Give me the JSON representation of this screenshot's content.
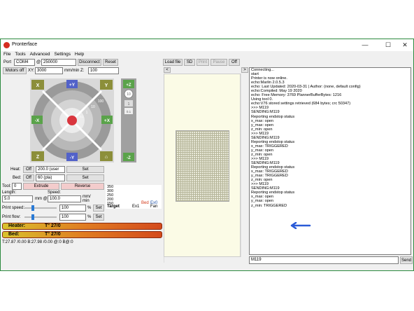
{
  "window": {
    "title": "Pronterface",
    "minimize": "—",
    "maximize": "☐",
    "close": "✕"
  },
  "menu": [
    "File",
    "Tools",
    "Advanced",
    "Settings",
    "Help"
  ],
  "toolbar": {
    "port_label": "Port",
    "port_value": "COM4",
    "at": "@",
    "baud_value": "250000",
    "disconnect": "Disconnect",
    "reset": "Reset",
    "motors_off": "Motors off",
    "xy_label": "XY:",
    "xy_speed": "3000",
    "z_label": "mm/min Z:",
    "z_speed": "100"
  },
  "jog": {
    "home_x": "X",
    "home_y": "Y",
    "home_z": "Z",
    "home_all": "⌂",
    "plus_y": "+Y",
    "minus_y": "-Y",
    "plus_x": "+X",
    "minus_x": "-X",
    "ring_labels": [
      "100",
      "10",
      "1",
      "0.1"
    ],
    "z_steps": [
      "10",
      "1",
      "0.1"
    ],
    "plus_z": "+Z",
    "minus_z": "-Z"
  },
  "temp": {
    "heat_label": "Heat:",
    "heat_off": "Off",
    "heat_value": "200.0 (user",
    "set": "Set",
    "bed_label": "Bed:",
    "bed_off": "Off",
    "bed_value": "60 (pla)",
    "tool_label": "Tool:",
    "tool_value": "0",
    "extrude": "Extrude",
    "reverse": "Reverse",
    "length_label": "Length:",
    "length_value": "5.0",
    "mm_at": "mm @",
    "speed_label": "Speed:",
    "speed_value": "100.0",
    "mm_min": "mm/\nmin",
    "print_speed_label": "Print speed:",
    "print_speed_value": "100",
    "pct": "%",
    "print_flow_label": "Print flow:",
    "print_flow_value": "100"
  },
  "graph": {
    "ticks": [
      "350",
      "300",
      "250",
      "200",
      "150",
      "100",
      "50"
    ],
    "legend_target": "Target",
    "legend_ex1": "Ex1",
    "legend_bed": "Bed",
    "legend_ex0": "Ex0",
    "legend_fan": "Fan"
  },
  "gauges": {
    "heater": "Heater:",
    "heater_val": "T° 27/0",
    "bed": "Bed:",
    "bed_val": "T° 27/0"
  },
  "status": "T:27.87 /0.00 B:27.98 /0.00 @:0 B@:0",
  "center": {
    "load_file": "Load file",
    "sd": "SD",
    "print": "Print",
    "pause": "Pause",
    "off": "Off",
    "prev": "<",
    "next": ">"
  },
  "console_lines": [
    "Connecting...",
    "start",
    "Printer is now online.",
    "echo:Marlin 2.0.5.3",
    "echo: Last Updated: 2020-03-31 | Author: (none, default config)",
    "echo:Compiled: May 19 2020",
    "echo: Free Memory: 3769  PlannerBufferBytes: 1216",
    "Using tool 0.",
    "echo:V76 stored settings retrieved (684 bytes; crc 50347)",
    ">>> M119",
    "SENDING:M119",
    "Reporting endstop status",
    "x_max: open",
    "y_max: open",
    "z_min: open",
    ">>> M119",
    "SENDING:M119",
    "Reporting endstop status",
    "x_max: TRIGGERED",
    "y_max: open",
    "z_min: open",
    ">>> M119",
    "SENDING:M119",
    "Reporting endstop status",
    "x_max: TRIGGERED",
    "y_max: TRIGGERED",
    "z_min: open",
    ">>> M119",
    "SENDING:M119",
    "Reporting endstop status",
    "x_max: open",
    "y_max: open",
    "z_min: TRIGGERED"
  ],
  "command": {
    "value": "M119",
    "send": "Send"
  },
  "colors": {
    "accent_arrow": "#2a5bd7",
    "jog_green": "#5aa34a",
    "jog_blue": "#5262c9",
    "home_olive": "#8c8f3a",
    "gauge_red": "#c9361b"
  }
}
